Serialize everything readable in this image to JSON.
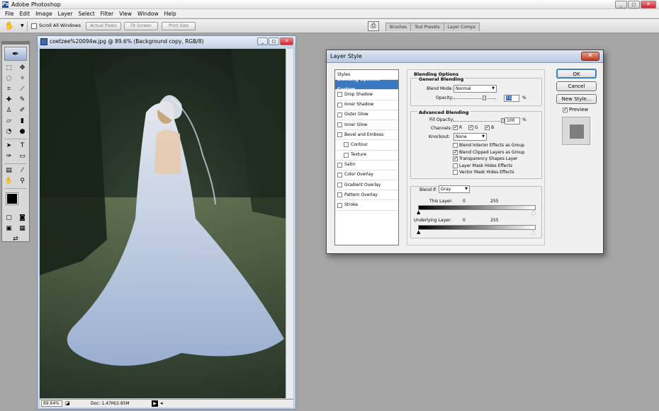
{
  "app": {
    "title": "Adobe Photoshop",
    "logo": "Ps"
  },
  "window_controls": {
    "minimize": "_",
    "maximize": "◻",
    "close": "✕"
  },
  "menu": [
    "File",
    "Edit",
    "Image",
    "Layer",
    "Select",
    "Filter",
    "View",
    "Window",
    "Help"
  ],
  "options_bar": {
    "hand_icon": "hand-icon",
    "scroll_all_windows": "Scroll All Windows",
    "scroll_all_checked": false,
    "actual_pixels": "Actual Pixels",
    "fit_screen": "Fit Screen",
    "print_size": "Print Size",
    "palette_tabs": [
      "Brushes",
      "Tool Presets",
      "Layer Comps"
    ]
  },
  "document": {
    "title": "coetzee%20094w.jpg @ 89.6% (Background copy, RGB/8)",
    "zoom": "89.64%",
    "doc_size": "Doc: 1.47M/2.95M"
  },
  "dialog": {
    "title": "Layer Style",
    "styles_header": "Styles",
    "styles": [
      {
        "label": "Blending Options: Custom",
        "selected": true,
        "checkbox": false,
        "indent": false
      },
      {
        "label": "Drop Shadow",
        "checkbox": true,
        "checked": false,
        "indent": false
      },
      {
        "label": "Inner Shadow",
        "checkbox": true,
        "checked": false,
        "indent": false
      },
      {
        "label": "Outer Glow",
        "checkbox": true,
        "checked": false,
        "indent": false
      },
      {
        "label": "Inner Glow",
        "checkbox": true,
        "checked": false,
        "indent": false
      },
      {
        "label": "Bevel and Emboss",
        "checkbox": true,
        "checked": false,
        "indent": false
      },
      {
        "label": "Contour",
        "checkbox": true,
        "checked": false,
        "indent": true
      },
      {
        "label": "Texture",
        "checkbox": true,
        "checked": false,
        "indent": true
      },
      {
        "label": "Satin",
        "checkbox": true,
        "checked": false,
        "indent": false
      },
      {
        "label": "Color Overlay",
        "checkbox": true,
        "checked": false,
        "indent": false
      },
      {
        "label": "Gradient Overlay",
        "checkbox": true,
        "checked": false,
        "indent": false
      },
      {
        "label": "Pattern Overlay",
        "checkbox": true,
        "checked": false,
        "indent": false
      },
      {
        "label": "Stroke",
        "checkbox": true,
        "checked": false,
        "indent": false
      }
    ],
    "blending_options": "Blending Options",
    "general_blending": "General Blending",
    "blend_mode_label": "Blend Mode:",
    "blend_mode": "Normal",
    "opacity_label": "Opacity:",
    "opacity": "71",
    "opacity_level": 0.71,
    "percent": "%",
    "advanced_blending": "Advanced Blending",
    "fill_opacity_label": "Fill Opacity:",
    "fill_opacity": "100",
    "fill_opacity_level": 1.0,
    "channels_label": "Channels:",
    "channel_r": "R",
    "channel_g": "G",
    "channel_b": "B",
    "knockout_label": "Knockout:",
    "knockout": "None",
    "adv_options": [
      {
        "label": "Blend Interior Effects as Group",
        "checked": false
      },
      {
        "label": "Blend Clipped Layers as Group",
        "checked": true
      },
      {
        "label": "Transparency Shapes Layer",
        "checked": true
      },
      {
        "label": "Layer Mask Hides Effects",
        "checked": false
      },
      {
        "label": "Vector Mask Hides Effects",
        "checked": false
      }
    ],
    "blend_if_label": "Blend If:",
    "blend_if": "Gray",
    "this_layer_label": "This Layer:",
    "this_layer_low": "0",
    "this_layer_high": "255",
    "underlying_label": "Underlying Layer:",
    "underlying_low": "0",
    "underlying_high": "255",
    "ok": "OK",
    "cancel": "Cancel",
    "new_style": "New Style...",
    "preview": "Preview",
    "preview_checked": true
  }
}
